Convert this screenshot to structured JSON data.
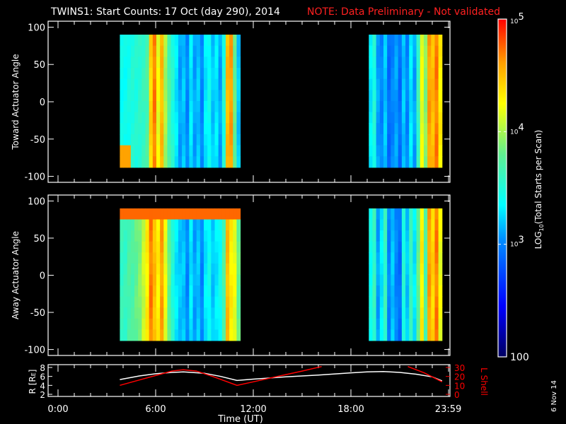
{
  "chart_data": {
    "type": "heatmap",
    "title": "TWINS1: Start Counts: 17 Oct (day 290), 2014",
    "note": "NOTE: Data Preliminary - Not validated",
    "date_stamp": "6 Nov 14",
    "xlabel": "Time (UT)",
    "x_ticks": [
      "0:00",
      "6:00",
      "12:00",
      "18:00",
      "23:59"
    ],
    "x_tick_hours": [
      0,
      6,
      12,
      18,
      23.98
    ],
    "xlim_hours": [
      0,
      24
    ],
    "colorbar": {
      "label": "LOG10(Total Starts per Scan)",
      "label_main": "LOG",
      "label_sub": "10",
      "label_rest": "(Total Starts per Scan)",
      "ticks": [
        "100",
        "10",
        "10",
        "10"
      ],
      "tick_exps": [
        "",
        "3",
        "4",
        "5"
      ],
      "log_range": [
        2,
        5
      ]
    },
    "panels": [
      {
        "ylabel": "Toward Actuator Angle",
        "y_ticks": [
          "100",
          "50",
          "0",
          "-50",
          "-100"
        ],
        "ylim": [
          -108,
          108
        ],
        "data_angle_range": [
          -88,
          90
        ],
        "blocks": [
          {
            "start_h": 3.8,
            "end_h": 11.2,
            "log_counts": [
              3.4,
              3.4,
              3.45,
              3.5,
              3.5,
              3.55,
              3.6,
              3.7,
              4.4,
              4.7,
              4.2,
              4.5,
              4.0,
              3.7,
              3.5,
              3.3,
              3.1,
              3.2,
              3.0,
              3.3,
              3.1,
              3.2,
              3.0,
              3.3,
              3.4,
              3.2,
              3.3,
              3.1,
              3.5,
              4.5,
              4.6,
              3.8,
              3.2
            ]
          },
          {
            "start_h": 19.1,
            "end_h": 23.6,
            "log_counts": [
              3.3,
              3.5,
              3.1,
              3.0,
              3.2,
              2.9,
              3.0,
              3.1,
              2.9,
              3.2,
              3.0,
              3.3,
              3.1,
              3.6,
              4.2,
              3.9,
              4.6,
              4.5,
              4.7,
              4.3
            ]
          }
        ]
      },
      {
        "ylabel": "Away Actuator Angle",
        "y_ticks": [
          "100",
          "50",
          "0",
          "-50",
          "-100"
        ],
        "ylim": [
          -108,
          108
        ],
        "data_angle_range": [
          -88,
          90
        ],
        "blocks": [
          {
            "start_h": 3.8,
            "end_h": 11.2,
            "log_counts": [
              3.6,
              3.6,
              3.7,
              3.7,
              3.8,
              3.9,
              4.1,
              4.3,
              4.7,
              4.5,
              4.3,
              4.6,
              4.2,
              3.8,
              3.5,
              3.3,
              3.2,
              3.2,
              3.0,
              3.3,
              3.1,
              3.2,
              3.0,
              3.3,
              3.4,
              3.2,
              3.3,
              3.4,
              3.7,
              4.5,
              4.3,
              4.2,
              3.8
            ]
          },
          {
            "start_h": 19.1,
            "end_h": 23.6,
            "log_counts": [
              3.4,
              3.6,
              3.1,
              3.3,
              3.6,
              3.0,
              3.2,
              3.0,
              2.9,
              3.5,
              3.2,
              3.6,
              3.3,
              3.8,
              4.3,
              3.7,
              4.6,
              4.4,
              4.7,
              4.2
            ]
          }
        ]
      }
    ],
    "orbit": {
      "left_label": "R [R",
      "left_label_sub": "E",
      "left_label_end": "]",
      "left_ticks": [
        "2",
        "4",
        "6",
        "8"
      ],
      "left_range": [
        2,
        8
      ],
      "right_label": "L Shell",
      "right_ticks": [
        "0",
        "10",
        "20",
        "30"
      ],
      "right_range": [
        0,
        30
      ],
      "r_series": {
        "name": "R",
        "color": "#ffffff",
        "hours": [
          3.8,
          5,
          6,
          7,
          7.7,
          9,
          10,
          11,
          12,
          14,
          16,
          18,
          19,
          20,
          21,
          22,
          23,
          23.6
        ],
        "values": [
          5.3,
          6.1,
          6.6,
          6.9,
          7.0,
          6.7,
          6.0,
          5.1,
          5.4,
          5.9,
          6.3,
          6.8,
          7.0,
          7.1,
          6.9,
          6.5,
          5.9,
          5.0
        ]
      },
      "l_series": {
        "name": "L Shell",
        "color": "#ff0000",
        "hours": [
          3.8,
          5,
          6,
          7,
          7.7,
          8.5,
          9.5,
          11,
          12,
          13,
          14,
          15,
          16.2,
          null,
          21.5,
          22.5,
          23.6
        ],
        "values": [
          10,
          16,
          21,
          26,
          27.5,
          26,
          20,
          10,
          14,
          18,
          22,
          26,
          31,
          null,
          31,
          24,
          14
        ]
      }
    }
  }
}
